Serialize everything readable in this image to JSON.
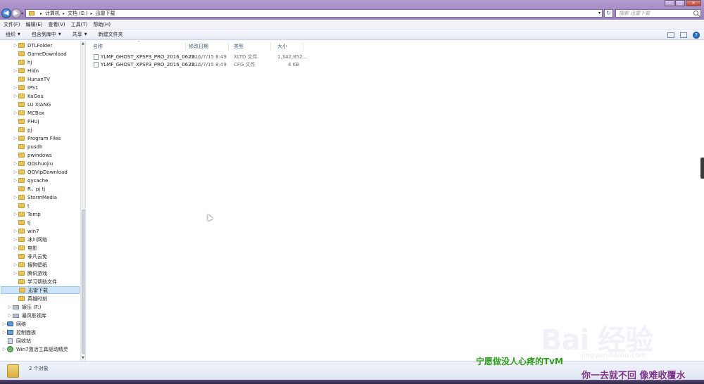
{
  "address": {
    "crumbs": [
      "计算机",
      "文档 (E:)",
      "迅雷下载"
    ],
    "search_placeholder": "搜索 迅雷下载"
  },
  "menubar": [
    "文件(F)",
    "编辑(E)",
    "查看(V)",
    "工具(T)",
    "帮助(H)"
  ],
  "toolbar": {
    "organize": "组织",
    "include_library": "包含到库中",
    "share": "共享",
    "new_folder": "新建文件夹"
  },
  "navpane": {
    "items": [
      {
        "label": "DTLFolder",
        "icon": "folder",
        "expandable": true
      },
      {
        "label": "GameDownload",
        "icon": "folder",
        "expandable": false
      },
      {
        "label": "hj",
        "icon": "folder",
        "expandable": false
      },
      {
        "label": "Hldn",
        "icon": "folder",
        "expandable": true
      },
      {
        "label": "HunanTV",
        "icon": "folder",
        "expandable": false
      },
      {
        "label": "IPS1",
        "icon": "folder",
        "expandable": true
      },
      {
        "label": "KuGou",
        "icon": "folder",
        "expandable": true
      },
      {
        "label": "LU XIANG",
        "icon": "folder",
        "expandable": false
      },
      {
        "label": "MCBox",
        "icon": "folder",
        "expandable": true
      },
      {
        "label": "PHUj",
        "icon": "folder",
        "expandable": false
      },
      {
        "label": "pj",
        "icon": "folder",
        "expandable": false
      },
      {
        "label": "Program Files",
        "icon": "folder",
        "expandable": true
      },
      {
        "label": "pusdh",
        "icon": "folder",
        "expandable": false
      },
      {
        "label": "pwindows",
        "icon": "folder",
        "expandable": false
      },
      {
        "label": "QQshuojiu",
        "icon": "folder",
        "expandable": true
      },
      {
        "label": "QQVipDownload",
        "icon": "folder",
        "expandable": true
      },
      {
        "label": "qycache",
        "icon": "folder",
        "expandable": true
      },
      {
        "label": "R，pj tj",
        "icon": "folder",
        "expandable": false
      },
      {
        "label": "StormMedia",
        "icon": "folder",
        "expandable": true
      },
      {
        "label": "t",
        "icon": "folder",
        "expandable": false
      },
      {
        "label": "Temp",
        "icon": "folder",
        "expandable": true
      },
      {
        "label": "tj",
        "icon": "folder",
        "expandable": false
      },
      {
        "label": "win7",
        "icon": "folder",
        "expandable": true
      },
      {
        "label": "冰川网络",
        "icon": "folder",
        "expandable": true
      },
      {
        "label": "电影",
        "icon": "folder",
        "expandable": true
      },
      {
        "label": "非凡云免",
        "icon": "folder",
        "expandable": false
      },
      {
        "label": "搜狗壁纸",
        "icon": "folder",
        "expandable": true
      },
      {
        "label": "腾讯游戏",
        "icon": "folder",
        "expandable": true
      },
      {
        "label": "学习帮助文件",
        "icon": "folder",
        "expandable": false
      },
      {
        "label": "迅雷下载",
        "icon": "folder",
        "expandable": false,
        "selected": true
      },
      {
        "label": "英雄时刻",
        "icon": "folder",
        "expandable": false
      },
      {
        "label": "娱乐 (F:)",
        "icon": "drive",
        "expandable": true
      },
      {
        "label": "暴风影视库",
        "icon": "media",
        "expandable": true
      },
      {
        "label": "网络",
        "icon": "network",
        "expandable": true
      },
      {
        "label": "控制面板",
        "icon": "control-panel",
        "expandable": true
      },
      {
        "label": "回收站",
        "icon": "recycle-bin",
        "expandable": false
      },
      {
        "label": "Win7激活工具驱动精灵",
        "icon": "app",
        "expandable": true
      }
    ]
  },
  "columns": {
    "name": "名称",
    "date": "修改日期",
    "type": "类型",
    "size": "大小"
  },
  "files": [
    {
      "name": "YLMF_GHOST_XPSP3_PRO_2016_0623....",
      "date": "2016/7/15 8:49",
      "type": "XLTD 文件",
      "size": "1,342,852..."
    },
    {
      "name": "YLMF_GHOST_XPSP3_PRO_2016_0623....",
      "date": "2016/7/15 8:49",
      "type": "CFG 文件",
      "size": "4 KB"
    }
  ],
  "details": {
    "count": "2 个对象"
  },
  "watermark": {
    "brand": "Bai 经验",
    "url": "jingyan.baidu.com",
    "line1": "宁愿做没人心疼的TvM",
    "line2": "你一去就不回 像难收覆水"
  }
}
